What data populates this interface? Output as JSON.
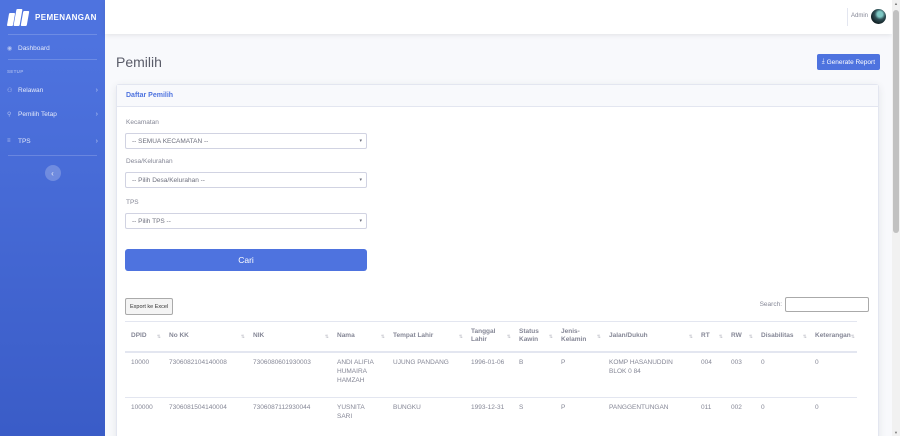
{
  "sidebar": {
    "brand": "PEMENANGAN",
    "dashboard": "Dashboard",
    "heading": "SETUP",
    "items": [
      {
        "label": "Relawan",
        "icon": "users-icon"
      },
      {
        "label": "Pemilih Tetap",
        "icon": "user-icon"
      },
      {
        "label": "TPS",
        "icon": "list-icon"
      }
    ],
    "toggle_icon": "‹"
  },
  "topbar": {
    "user": "Admin"
  },
  "page": {
    "title": "Pemilih",
    "report_button": "Generate Report",
    "card_title": "Daftar Pemilih"
  },
  "filters": {
    "kecamatan_label": "Kecamatan",
    "kecamatan_value": "-- SEMUA KECAMATAN --",
    "desa_label": "Desa/Kelurahan",
    "desa_value": "-- Pilih Desa/Kelurahan --",
    "tps_label": "TPS",
    "tps_value": "-- Pilih TPS --",
    "search_button": "Cari"
  },
  "table_tools": {
    "export_button": "Export ke Excel",
    "search_label": "Search:"
  },
  "table": {
    "headers": [
      "DPID",
      "No KK",
      "NIK",
      "Nama",
      "Tempat Lahir",
      "Tanggal Lahir",
      "Status Kawin",
      "Jenis-Kelamin",
      "Jalan/Dukuh",
      "RT",
      "RW",
      "Disabilitas",
      "Keterangan"
    ],
    "rows": [
      [
        "10000",
        "7306082104140008",
        "7306080601930003",
        "ANDI ALIFIA HUMAIRA HAMZAH",
        "UJUNG PANDANG",
        "1996-01-06",
        "B",
        "P",
        "KOMP HASANUDDIN BLOK 0 84",
        "004",
        "003",
        "0",
        "0"
      ],
      [
        "100000",
        "7306081504140004",
        "7306087112930044",
        "YUSNITA SARI",
        "BUNGKU",
        "1993-12-31",
        "S",
        "P",
        "PANGGENTUNGAN",
        "011",
        "002",
        "0",
        "0"
      ]
    ]
  }
}
